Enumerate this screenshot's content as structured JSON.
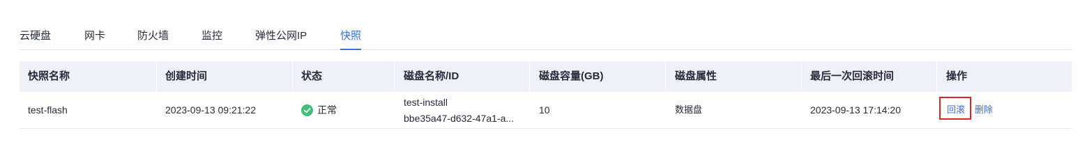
{
  "tabs": [
    {
      "label": "云硬盘"
    },
    {
      "label": "网卡"
    },
    {
      "label": "防火墙"
    },
    {
      "label": "监控"
    },
    {
      "label": "弹性公网IP"
    },
    {
      "label": "快照",
      "active": true
    }
  ],
  "table": {
    "columns": [
      "快照名称",
      "创建时间",
      "状态",
      "磁盘名称/ID",
      "磁盘容量(GB)",
      "磁盘属性",
      "最后一次回滚时间",
      "操作"
    ],
    "rows": [
      {
        "name": "test-flash",
        "created": "2023-09-13 09:21:22",
        "status": "正常",
        "status_icon": "check-circle-icon",
        "disk_name": "test-install",
        "disk_id": "bbe35a47-d632-47a1-a...",
        "capacity": "10",
        "attribute": "数据盘",
        "last_rollback": "2023-09-13 17:14:20",
        "actions": {
          "rollback": "回滚",
          "delete": "删除"
        }
      }
    ]
  },
  "colors": {
    "accent": "#3b6ed8",
    "status_ok": "#3fc07a",
    "header_bg": "#eef1f8",
    "highlight": "#e02424"
  }
}
